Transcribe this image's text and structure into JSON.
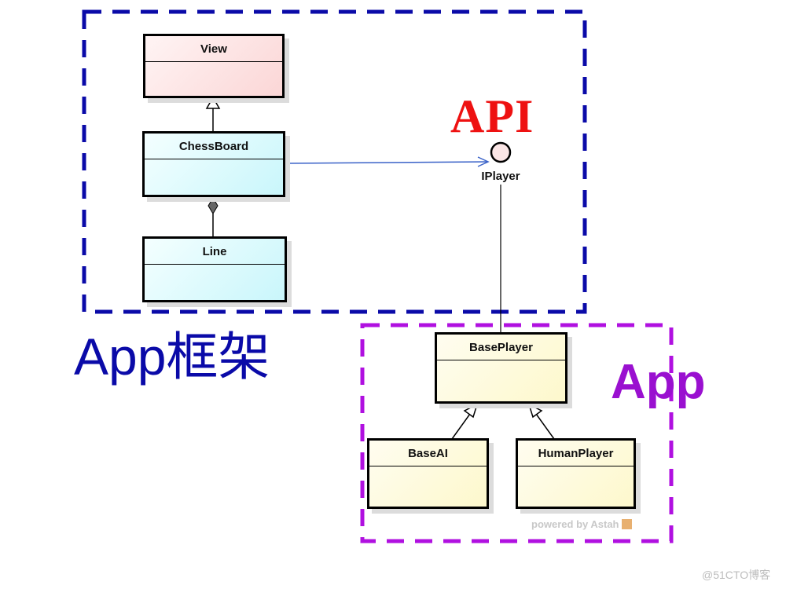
{
  "regions": {
    "framework": {
      "label": "App框架",
      "color": "#0a0aa8"
    },
    "app": {
      "label": "App",
      "color": "#9a10d0"
    }
  },
  "api_label": {
    "text": "API",
    "color": "#ee1111"
  },
  "interface": {
    "name": "IPlayer"
  },
  "classes": {
    "view": {
      "name": "View"
    },
    "chessboard": {
      "name": "ChessBoard"
    },
    "line": {
      "name": "Line"
    },
    "baseplayer": {
      "name": "BasePlayer"
    },
    "baseai": {
      "name": "BaseAI"
    },
    "humanplayer": {
      "name": "HumanPlayer"
    }
  },
  "relations": [
    {
      "type": "generalization",
      "from": "ChessBoard",
      "to": "View"
    },
    {
      "type": "composition",
      "from": "Line",
      "to": "ChessBoard"
    },
    {
      "type": "dependency",
      "from": "ChessBoard",
      "to": "IPlayer"
    },
    {
      "type": "realization",
      "from": "BasePlayer",
      "to": "IPlayer"
    },
    {
      "type": "generalization",
      "from": "BaseAI",
      "to": "BasePlayer"
    },
    {
      "type": "generalization",
      "from": "HumanPlayer",
      "to": "BasePlayer"
    }
  ],
  "watermark": {
    "powered_by": "powered by Astah",
    "site": "@51CTO博客"
  }
}
